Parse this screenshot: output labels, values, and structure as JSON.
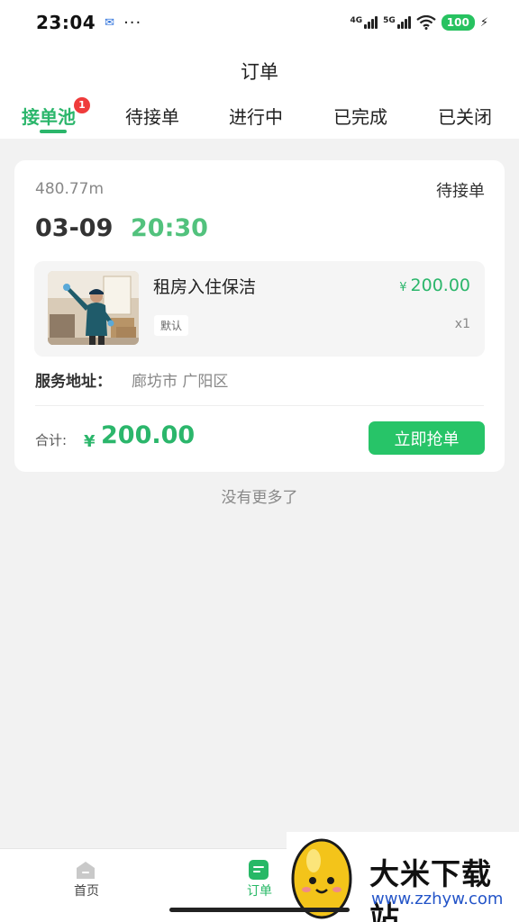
{
  "status_bar": {
    "time": "23:04",
    "network_1": "4G",
    "network_2": "5G",
    "battery": "100"
  },
  "header": {
    "title": "订单",
    "tabs": [
      {
        "label": "接单池",
        "active": true,
        "badge": "1"
      },
      {
        "label": "待接单",
        "active": false
      },
      {
        "label": "进行中",
        "active": false
      },
      {
        "label": "已完成",
        "active": false
      },
      {
        "label": "已关闭",
        "active": false
      }
    ]
  },
  "order": {
    "distance": "480.77m",
    "status": "待接单",
    "date": "03-09",
    "time": "20:30",
    "item": {
      "name": "租房入住保洁",
      "currency": "¥",
      "price": "200.00",
      "spec": "默认",
      "quantity": "x1"
    },
    "address_label": "服务地址：",
    "address_value": "廊坊市 广阳区",
    "total_label": "合计:",
    "total_currency": "¥",
    "total_value": "200.00",
    "grab_button": "立即抢单"
  },
  "list_end_text": "没有更多了",
  "bottom_nav": {
    "items": [
      {
        "label": "首页",
        "icon": "home-icon",
        "active": false
      },
      {
        "label": "订单",
        "icon": "orders-icon",
        "active": true
      }
    ]
  },
  "watermark": {
    "title": "大米下载站",
    "url": "www.zzhyw.com"
  },
  "colors": {
    "accent": "#2bb66b",
    "button": "#27c468",
    "badge": "#ef3b3b",
    "background": "#f2f2f2"
  }
}
